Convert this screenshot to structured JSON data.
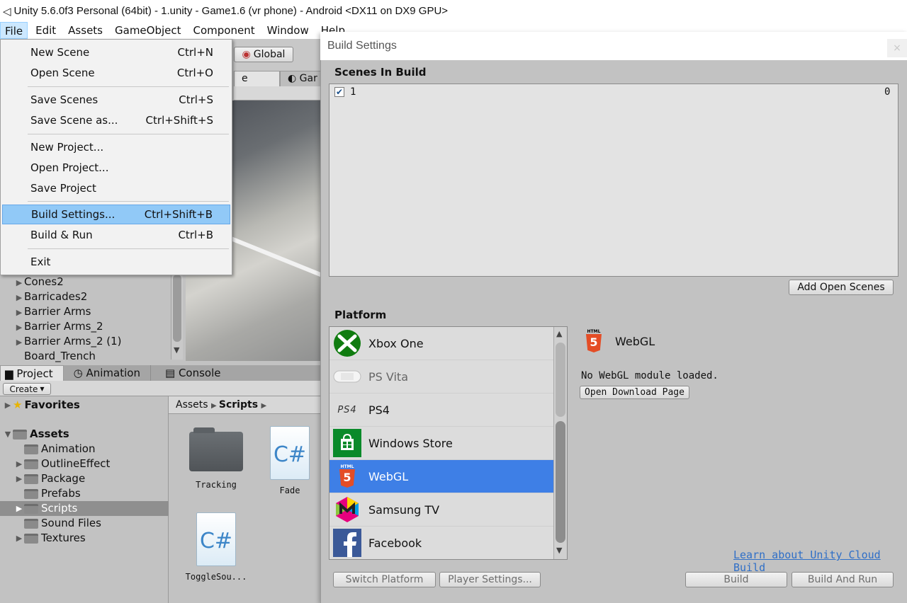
{
  "title_bar": {
    "title": "Unity 5.6.0f3 Personal (64bit) - 1.unity - Game1.6 (vr phone) - Android <DX11 on DX9 GPU>"
  },
  "menu_bar": {
    "items": [
      "File",
      "Edit",
      "Assets",
      "GameObject",
      "Component",
      "Window",
      "Help"
    ]
  },
  "toolbar": {
    "global_label": "Global"
  },
  "scene_tabs": {
    "scene": "e",
    "game": "Gar"
  },
  "file_menu": {
    "items": [
      {
        "label": "New Scene",
        "shortcut": "Ctrl+N"
      },
      {
        "label": "Open Scene",
        "shortcut": "Ctrl+O"
      },
      {
        "label": "Save Scenes",
        "shortcut": "Ctrl+S"
      },
      {
        "label": "Save Scene as...",
        "shortcut": "Ctrl+Shift+S"
      },
      {
        "label": "New Project...",
        "shortcut": ""
      },
      {
        "label": "Open Project...",
        "shortcut": ""
      },
      {
        "label": "Save Project",
        "shortcut": ""
      },
      {
        "label": "Build Settings...",
        "shortcut": "Ctrl+Shift+B"
      },
      {
        "label": "Build & Run",
        "shortcut": "Ctrl+B"
      },
      {
        "label": "Exit",
        "shortcut": ""
      }
    ],
    "highlighted": "Build Settings..."
  },
  "hierarchy": {
    "items": [
      "Cones2",
      "Barricades2",
      "Barrier Arms",
      "Barrier Arms_2",
      "Barrier Arms_2 (1)",
      "Board_Trench"
    ]
  },
  "bottom_tabs": [
    "Project",
    "Animation",
    "Console"
  ],
  "project": {
    "create_label": "Create",
    "favorites_label": "Favorites",
    "assets_label": "Assets",
    "folders": [
      "Animation",
      "OutlineEffect",
      "Package",
      "Prefabs",
      "Scripts",
      "Sound Files",
      "Textures"
    ],
    "selected_folder": "Scripts",
    "breadcrumb": {
      "root": "Assets",
      "current": "Scripts"
    },
    "asset_items": [
      "Tracking",
      "Fade",
      "ToggleSou..."
    ]
  },
  "build_settings": {
    "window_title": "Build Settings",
    "close_glyph": "×",
    "scenes_header": "Scenes In Build",
    "scenes": [
      {
        "name": "1",
        "index": "0",
        "checked": true
      }
    ],
    "add_open_scenes_label": "Add Open Scenes",
    "platform_header": "Platform",
    "platforms": [
      "Xbox One",
      "PS Vita",
      "PS4",
      "Windows Store",
      "WebGL",
      "Samsung TV",
      "Facebook"
    ],
    "selected_platform": "WebGL",
    "detail": {
      "platform_name": "WebGL",
      "message": "No WebGL module loaded.",
      "download_label": "Open Download Page"
    },
    "cloud_build_link": "Learn about Unity Cloud Build",
    "switch_platform_label": "Switch Platform",
    "player_settings_label": "Player Settings...",
    "build_label": "Build",
    "build_and_run_label": "Build And Run"
  },
  "colors": {
    "selection_blue": "#3e7fe6",
    "menu_highlight": "#91c9f7",
    "link_blue": "#2f6fc7"
  }
}
